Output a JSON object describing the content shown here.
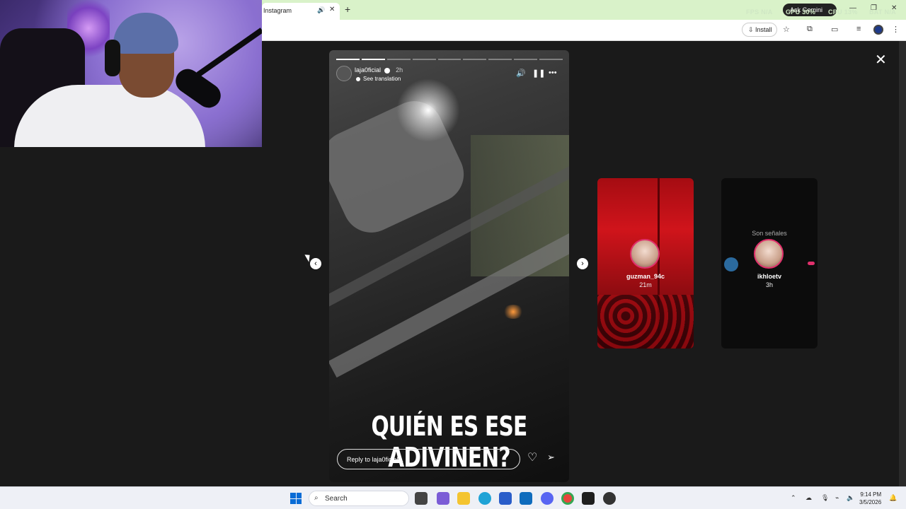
{
  "browser": {
    "tab_title": "Instagram",
    "tab_audio_icon": "speaker-icon",
    "tab_close": "✕",
    "new_tab": "+",
    "gemini_label": "Ask Gemini",
    "overlay_stats": [
      "FPS N/A",
      "GPU 30%",
      "CPU 13%",
      "BAT N/A"
    ],
    "install_label": "Install",
    "window_controls": [
      "—",
      "❐",
      "✕"
    ]
  },
  "story": {
    "username": "laja0ficial",
    "time": "2h",
    "translate_label": "See translation",
    "caption": "QUIÉN ES ESE ADIVINEN?",
    "reply_placeholder": "Reply to laja0ficial...",
    "progress_segments_total": 9,
    "progress_segments_done": 2
  },
  "previews": [
    {
      "username": "guzman_94c",
      "time": "21m"
    },
    {
      "username": "ikhloetv",
      "time": "3h",
      "text": "Son señales"
    }
  ],
  "taskbar": {
    "search_placeholder": "Search",
    "time": "9:14 PM",
    "date": "3/5/2026"
  },
  "colors": {
    "tab_strip": "#d9f2c9",
    "ig_background": "#1a1a1a",
    "story_ring": "#e1306c",
    "windows_blue": "#0a6cd6"
  }
}
